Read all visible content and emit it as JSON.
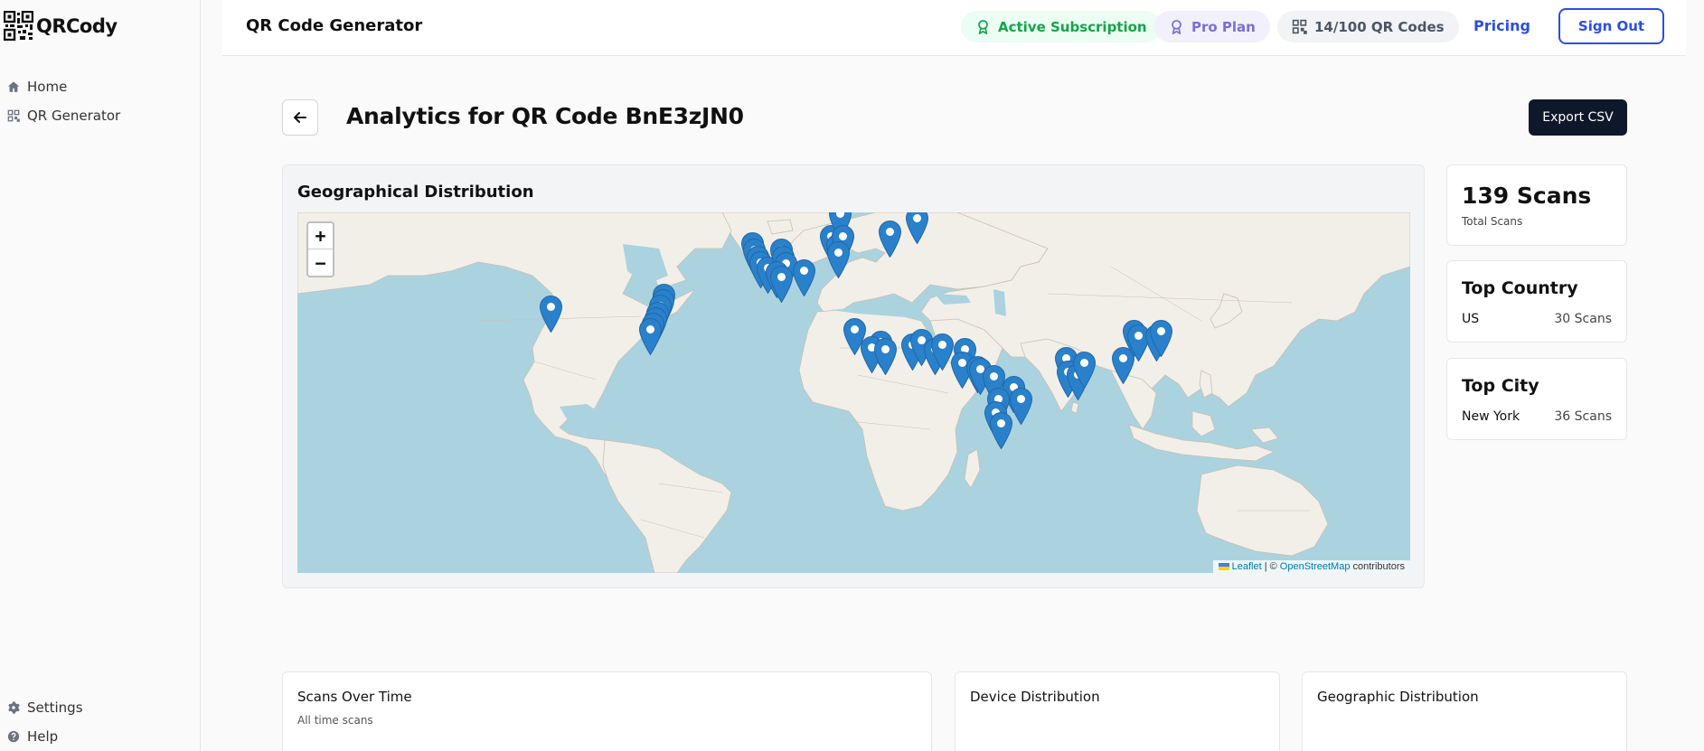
{
  "sidebar": {
    "brand": "QRCody",
    "items": [
      {
        "label": "Home",
        "icon": "home-icon"
      },
      {
        "label": "QR Generator",
        "icon": "grid-icon"
      }
    ],
    "footer": [
      {
        "label": "Settings",
        "icon": "gear-icon"
      },
      {
        "label": "Help",
        "icon": "help-icon"
      }
    ]
  },
  "header": {
    "title": "QR Code Generator",
    "subscription": "Active Subscription",
    "plan": "Pro Plan",
    "codes": "14/100 QR Codes",
    "pricing": "Pricing",
    "signout": "Sign Out"
  },
  "page": {
    "title": "Analytics for QR Code BnE3zJN0",
    "export": "Export CSV"
  },
  "map": {
    "title": "Geographical Distribution",
    "zoom_in": "+",
    "zoom_out": "−",
    "attribution": {
      "leaflet": "Leaflet",
      "sep": "| ©",
      "osm": "OpenStreetMap",
      "suffix": "contributors"
    }
  },
  "stats": {
    "total": {
      "value": "139 Scans",
      "label": "Total Scans"
    },
    "country": {
      "title": "Top Country",
      "name": "US",
      "count": "30 Scans"
    },
    "city": {
      "title": "Top City",
      "name": "New York",
      "count": "36 Scans"
    }
  },
  "bottom_cards": [
    {
      "title": "Scans Over Time",
      "subtitle": "All time scans"
    },
    {
      "title": "Device Distribution",
      "subtitle": ""
    },
    {
      "title": "Geographic Distribution",
      "subtitle": ""
    }
  ],
  "colors": {
    "accent": "#2b4ee6",
    "success": "#16a34a",
    "plan": "#7c6fd1",
    "marker": "#2a81cb",
    "water": "#aad3df",
    "land": "#f2efe9"
  }
}
